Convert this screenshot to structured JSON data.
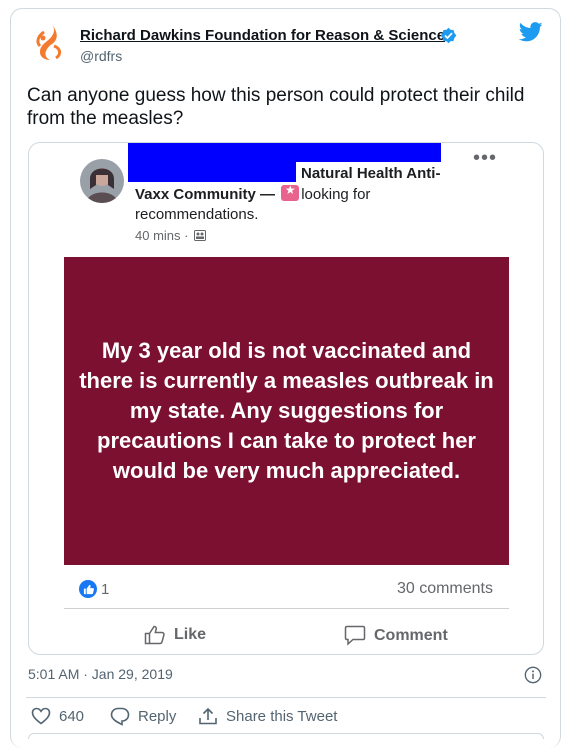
{
  "tweet": {
    "author_name": "Richard Dawkins Foundation for Reason & Science",
    "handle": "@rdfrs",
    "text": "Can anyone guess how this person could protect their child from the measles?",
    "timestamp": "5:01 AM · Jan 29, 2019",
    "likes": "640",
    "reply_label": "Reply",
    "share_label": "Share this Tweet"
  },
  "fb_post": {
    "group_line1": "Natural Health Anti-",
    "group_name_end": "Vaxx Community —",
    "looking_for": "looking for",
    "recommendations": "recommendations.",
    "time": "40 mins ·",
    "post_text": "My 3 year old is not vaccinated and there is currently a measles outbreak in my state. Any suggestions for precautions I can take to protect her would be very much appreciated.",
    "reaction_count": "1",
    "comments": "30 comments",
    "like_label": "Like",
    "comment_label": "Comment"
  },
  "colors": {
    "post_background": "#7b1030",
    "twitter_blue": "#1d9bf0",
    "fb_blue": "#1877f2",
    "redaction": "#0000ff"
  }
}
